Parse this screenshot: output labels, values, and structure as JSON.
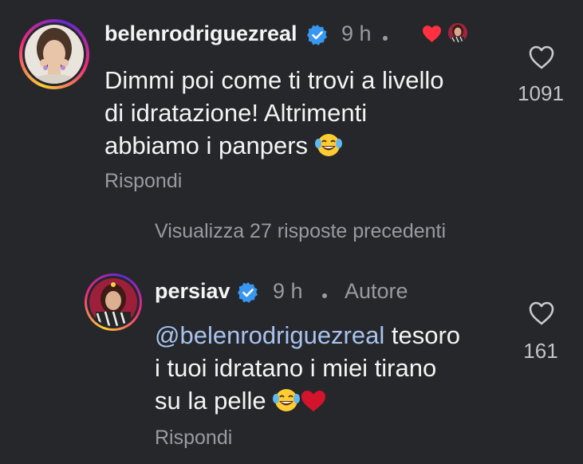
{
  "comments": [
    {
      "username": "belenrodriguezreal",
      "verified": true,
      "time": "9 h",
      "text_lines": [
        "Dimmi poi come ti trovi a livello",
        "di idratazione! Altrimenti",
        "abbiamo i panpers"
      ],
      "trailing_emoji": "laughing-tears-emoji",
      "reply_label": "Rispondi",
      "likes": "1091",
      "liked_by_author": true
    },
    {
      "username": "persiav",
      "verified": true,
      "time": "9 h",
      "author_tag": "Autore",
      "mention": "@belenrodriguezreal",
      "text_lines": [
        " tesoro",
        "i tuoi idratano i miei tirano",
        "su la pelle"
      ],
      "trailing_emoji": [
        "laughing-tears-emoji",
        "red-heart-emoji"
      ],
      "reply_label": "Rispondi",
      "likes": "161"
    }
  ],
  "view_replies_label": "Visualizza 27 risposte precedenti",
  "colors": {
    "background": "#26272b",
    "text": "#f4f4f4",
    "muted": "#9a9ba0",
    "mention": "#a8c3ef",
    "verified_badge": "#3897f0",
    "heart": "#ff3040"
  }
}
